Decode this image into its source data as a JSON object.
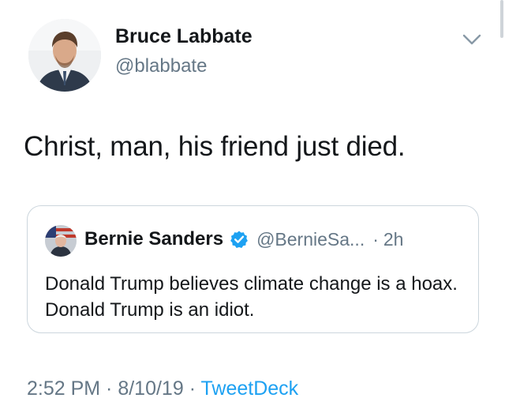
{
  "author": {
    "name": "Bruce Labbate",
    "handle": "@blabbate",
    "avatar_icon": "profile-photo"
  },
  "tweet": {
    "text": "Christ, man, his friend just died."
  },
  "quoted": {
    "name": "Bernie Sanders",
    "verified": true,
    "handle": "@BernieSa...",
    "separator": "·",
    "time": "2h",
    "text": "Donald Trump believes climate change is a hoax. Donald Trump is an idiot."
  },
  "meta": {
    "time": "2:52 PM",
    "sep1": " · ",
    "date": "8/10/19",
    "sep2": " · ",
    "source": "TweetDeck"
  },
  "colors": {
    "text": "#14171a",
    "secondary": "#657786",
    "link": "#1da1f2",
    "border": "#ccd6dd"
  }
}
